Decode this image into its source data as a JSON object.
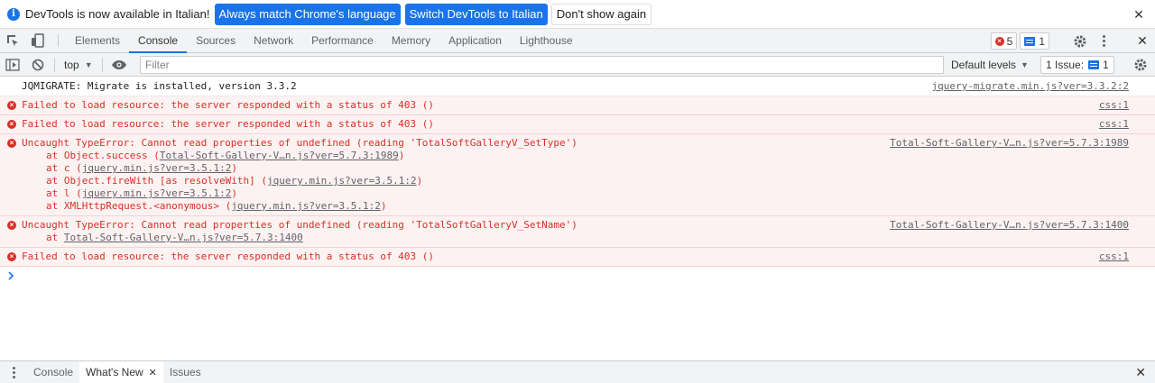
{
  "infobar": {
    "message": "DevTools is now available in Italian!",
    "btn_match": "Always match Chrome's language",
    "btn_switch": "Switch DevTools to Italian",
    "btn_dismiss": "Don't show again",
    "close": "✕"
  },
  "tabs": [
    "Elements",
    "Console",
    "Sources",
    "Network",
    "Performance",
    "Memory",
    "Application",
    "Lighthouse"
  ],
  "tabbar": {
    "error_count": "5",
    "message_count": "1"
  },
  "toolbar": {
    "context": "top",
    "filter_placeholder": "Filter",
    "levels": "Default levels",
    "issues_label": "1 Issue:",
    "issues_count": "1"
  },
  "messages": {
    "m0": {
      "text": "JQMIGRATE: Migrate is installed, version 3.3.2",
      "source": "jquery-migrate.min.js?ver=3.3.2:2"
    },
    "m1": {
      "text": "Failed to load resource: the server responded with a status of 403 ()",
      "source": "css:1"
    },
    "m2": {
      "text": "Failed to load resource: the server responded with a status of 403 ()",
      "source": "css:1"
    },
    "m3": {
      "text": "Uncaught TypeError: Cannot read properties of undefined (reading 'TotalSoftGalleryV_SetType')",
      "source": "Total-Soft-Gallery-V…n.js?ver=5.7.3:1989",
      "s1_pre": "at Object.success (",
      "s1_link": "Total-Soft-Gallery-V…n.js?ver=5.7.3:1989",
      "s1_post": ")",
      "s2_pre": "at c (",
      "s2_link": "jquery.min.js?ver=3.5.1:2",
      "s2_post": ")",
      "s3_pre": "at Object.fireWith [as resolveWith] (",
      "s3_link": "jquery.min.js?ver=3.5.1:2",
      "s3_post": ")",
      "s4_pre": "at l (",
      "s4_link": "jquery.min.js?ver=3.5.1:2",
      "s4_post": ")",
      "s5_pre": "at XMLHttpRequest.<anonymous> (",
      "s5_link": "jquery.min.js?ver=3.5.1:2",
      "s5_post": ")"
    },
    "m4": {
      "text": "Uncaught TypeError: Cannot read properties of undefined (reading 'TotalSoftGalleryV_SetName')",
      "source": "Total-Soft-Gallery-V…n.js?ver=5.7.3:1400",
      "s1_pre": "at ",
      "s1_link": "Total-Soft-Gallery-V…n.js?ver=5.7.3:1400"
    },
    "m5": {
      "text": "Failed to load resource: the server responded with a status of 403 ()",
      "source": "css:1"
    }
  },
  "drawer": {
    "tab_console": "Console",
    "tab_whatsnew": "What's New",
    "tab_issues": "Issues"
  },
  "colors": {
    "accent": "#1a73e8",
    "error": "#d93025",
    "error_bg": "#fdf2f2"
  }
}
